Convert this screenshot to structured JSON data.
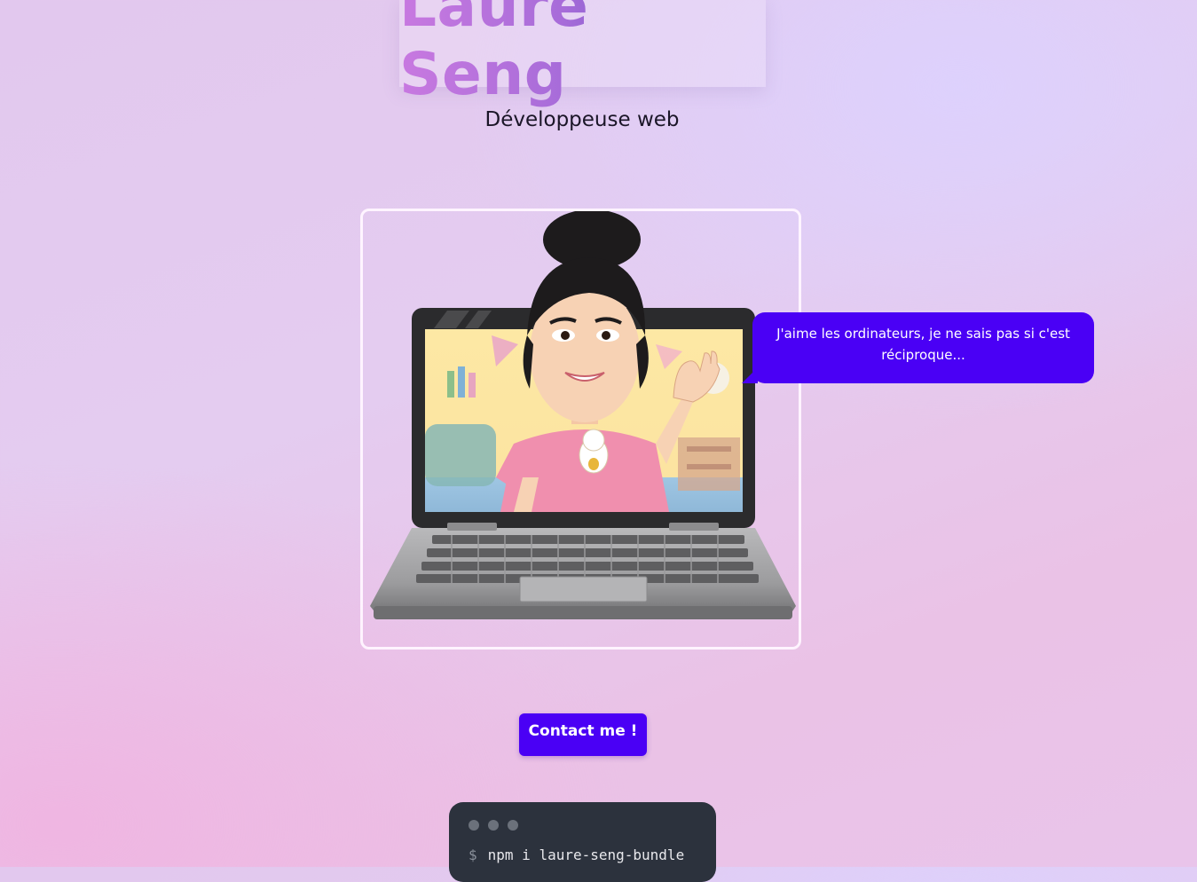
{
  "header": {
    "title": "Laure Seng",
    "subtitle": "Développeuse web"
  },
  "hero": {
    "avatar_label": "avatar-on-laptop",
    "speech_bubble": "J'aime les ordinateurs, je ne sais pas si c'est réciproque..."
  },
  "actions": {
    "contact_label": "Contact me !"
  },
  "terminal": {
    "prompt": "$",
    "command": "npm i laure-seng-bundle"
  },
  "colors": {
    "accent": "#4a00f5",
    "title_gradient_start": "#c879e0",
    "title_gradient_end": "#3d3aa9",
    "terminal_bg": "#2c323d"
  }
}
